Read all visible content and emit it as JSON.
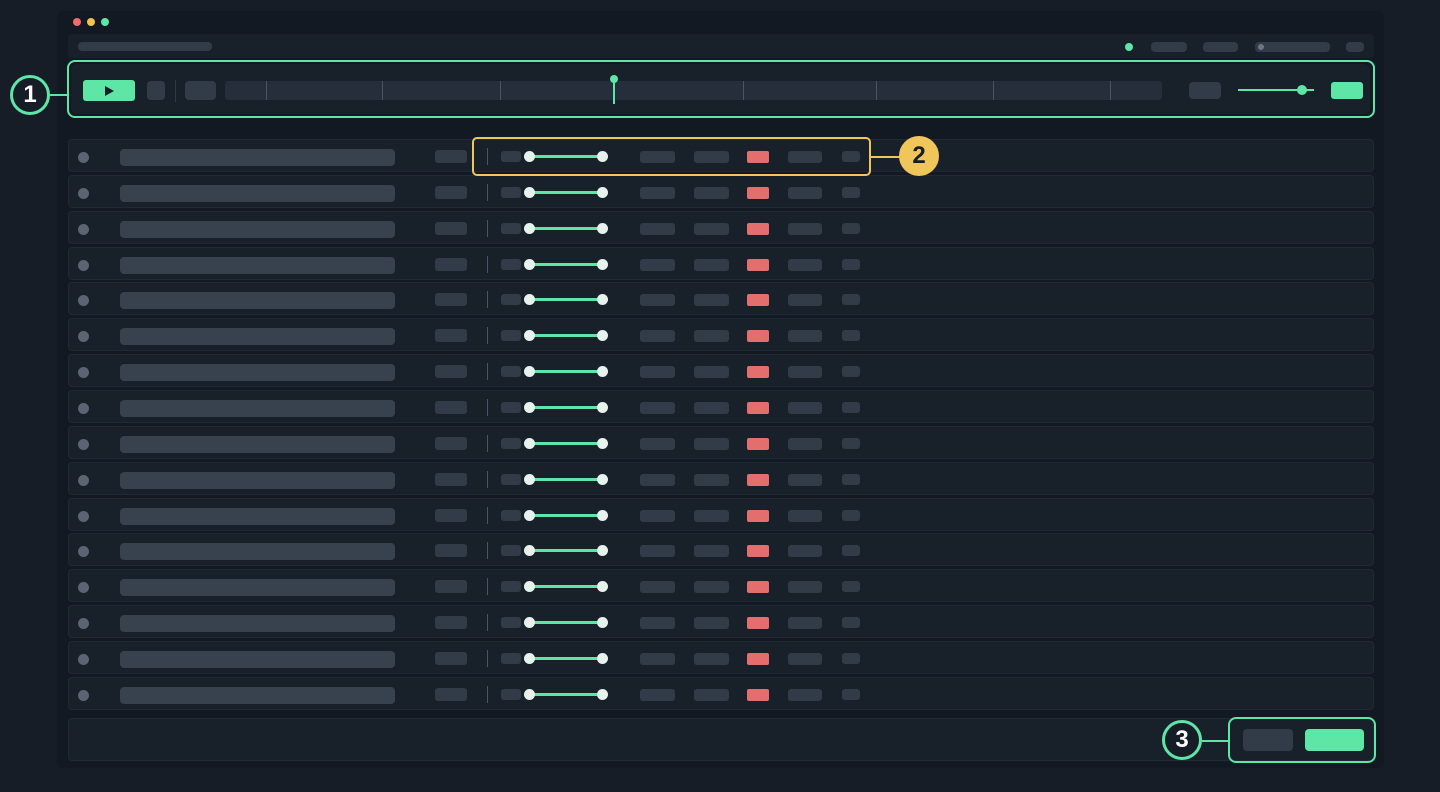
{
  "window": {
    "traffic_lights": [
      {
        "name": "close",
        "color": "#f06b6b"
      },
      {
        "name": "minimize",
        "color": "#f3c14f"
      },
      {
        "name": "maximize",
        "color": "#5ee6a7"
      }
    ]
  },
  "theme": {
    "accent": "#5ee6a7",
    "highlight": "#f0c55a",
    "mute": "#e46d6d",
    "background": "#161d26",
    "panel": "#18202a"
  },
  "callouts": [
    {
      "label": "1",
      "target": "transport-bar"
    },
    {
      "label": "2",
      "target": "track-row-controls"
    },
    {
      "label": "3",
      "target": "footer-action-buttons"
    }
  ],
  "transport": {
    "play_icon": "play-icon",
    "playhead_icon": "playhead-marker",
    "volume_level": 0.78,
    "playhead_position": 0.41
  },
  "tracks": {
    "count": 16,
    "row_icons": [
      "status-dot-icon",
      "pan-slider",
      "mute-indicator"
    ]
  }
}
